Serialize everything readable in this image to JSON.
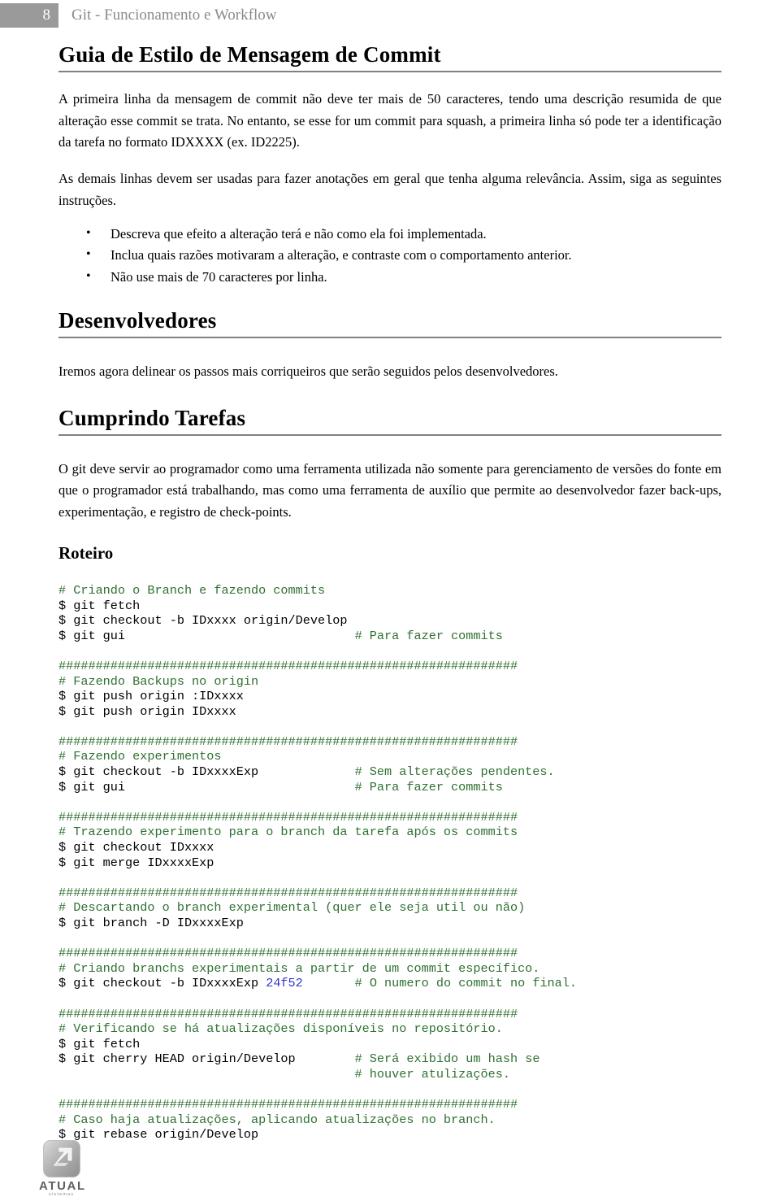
{
  "header": {
    "page_number": "8",
    "title": "Git - Funcionamento e Workflow",
    "box_color": "#9a9a9a",
    "title_color": "#8a8a8a"
  },
  "sections": {
    "commit_style": {
      "heading": "Guia de Estilo de Mensagem de Commit",
      "paragraph_1": "A primeira linha da mensagem de commit não deve ter mais de 50 caracteres, tendo uma descrição resumida de que alteração esse commit se trata. No entanto, se esse for um commit para squash, a primeira linha só pode ter a identificação da tarefa no formato IDXXXX (ex. ID2225).",
      "paragraph_2": "As demais linhas devem ser usadas para fazer anotações em geral que tenha alguma relevância. Assim, siga as seguintes instruções.",
      "bullets": [
        "Descreva que efeito a alteração terá e não como ela foi implementada.",
        "Inclua quais razões motivaram a alteração, e contraste com o comportamento anterior.",
        "Não use mais de 70 caracteres por linha."
      ]
    },
    "desenvolvedores": {
      "heading": "Desenvolvedores",
      "paragraph": "Iremos agora delinear os passos mais corriqueiros que serão seguidos pelos desenvolvedores."
    },
    "cumprindo_tarefas": {
      "heading": "Cumprindo Tarefas",
      "paragraph": "O git deve servir ao programador como uma ferramenta utilizada não somente para gerenciamento de versões do fonte em que o programador está trabalhando, mas como uma ferramenta de auxílio que permite ao desenvolvedor fazer back-ups, experimentação, e registro de check-points."
    },
    "roteiro": {
      "heading": "Roteiro"
    }
  },
  "code": {
    "comment_color": "#2f7031",
    "command_color": "#000000",
    "hash_color": "#3333cc",
    "separator": "##############################################################",
    "lines": [
      {
        "type": "comment",
        "text": "# Criando o Branch e fazendo commits"
      },
      {
        "type": "command",
        "text": "$ git fetch"
      },
      {
        "type": "command",
        "text": "$ git checkout -b IDxxxx origin/Develop"
      },
      {
        "type": "command",
        "text": "$ git gui",
        "comment": "# Para fazer commits",
        "comment_col": 40
      },
      {
        "type": "blank",
        "text": ""
      },
      {
        "type": "separator",
        "text": "##############################################################"
      },
      {
        "type": "comment",
        "text": "# Fazendo Backups no origin"
      },
      {
        "type": "command",
        "text": "$ git push origin :IDxxxx"
      },
      {
        "type": "command",
        "text": "$ git push origin IDxxxx"
      },
      {
        "type": "blank",
        "text": ""
      },
      {
        "type": "separator",
        "text": "##############################################################"
      },
      {
        "type": "comment",
        "text": "# Fazendo experimentos"
      },
      {
        "type": "command",
        "text": "$ git checkout -b IDxxxxExp",
        "comment": "# Sem alterações pendentes.",
        "comment_col": 40
      },
      {
        "type": "command",
        "text": "$ git gui",
        "comment": "# Para fazer commits",
        "comment_col": 40
      },
      {
        "type": "blank",
        "text": ""
      },
      {
        "type": "separator",
        "text": "##############################################################"
      },
      {
        "type": "comment",
        "text": "# Trazendo experimento para o branch da tarefa após os commits"
      },
      {
        "type": "command",
        "text": "$ git checkout IDxxxx"
      },
      {
        "type": "command",
        "text": "$ git merge IDxxxxExp"
      },
      {
        "type": "blank",
        "text": ""
      },
      {
        "type": "separator",
        "text": "##############################################################"
      },
      {
        "type": "comment",
        "text": "# Descartando o branch experimental (quer ele seja util ou não)"
      },
      {
        "type": "command",
        "text": "$ git branch -D IDxxxxExp"
      },
      {
        "type": "blank",
        "text": ""
      },
      {
        "type": "separator",
        "text": "##############################################################"
      },
      {
        "type": "comment",
        "text": "# Criando branchs experimentais a partir de um commit específico."
      },
      {
        "type": "command_hash",
        "text": "$ git checkout -b IDxxxxExp ",
        "hash": "24f52",
        "comment": "# O numero do commit no final.",
        "comment_col": 40
      },
      {
        "type": "blank",
        "text": ""
      },
      {
        "type": "separator",
        "text": "##############################################################"
      },
      {
        "type": "comment",
        "text": "# Verificando se há atualizações disponíveis no repositório."
      },
      {
        "type": "command",
        "text": "$ git fetch"
      },
      {
        "type": "command",
        "text": "$ git cherry HEAD origin/Develop",
        "comment": "# Será exibido um hash se",
        "comment_col": 40
      },
      {
        "type": "comment_only_indent",
        "text": "# houver atulizações.",
        "comment_col": 40
      },
      {
        "type": "blank",
        "text": ""
      },
      {
        "type": "separator",
        "text": "##############################################################"
      },
      {
        "type": "comment",
        "text": "# Caso haja atualizações, aplicando atualizações no branch."
      },
      {
        "type": "command",
        "text": "$ git rebase origin/Develop"
      }
    ]
  },
  "footer": {
    "logo_name": "ATUAL",
    "logo_tagline": "sistemas"
  }
}
